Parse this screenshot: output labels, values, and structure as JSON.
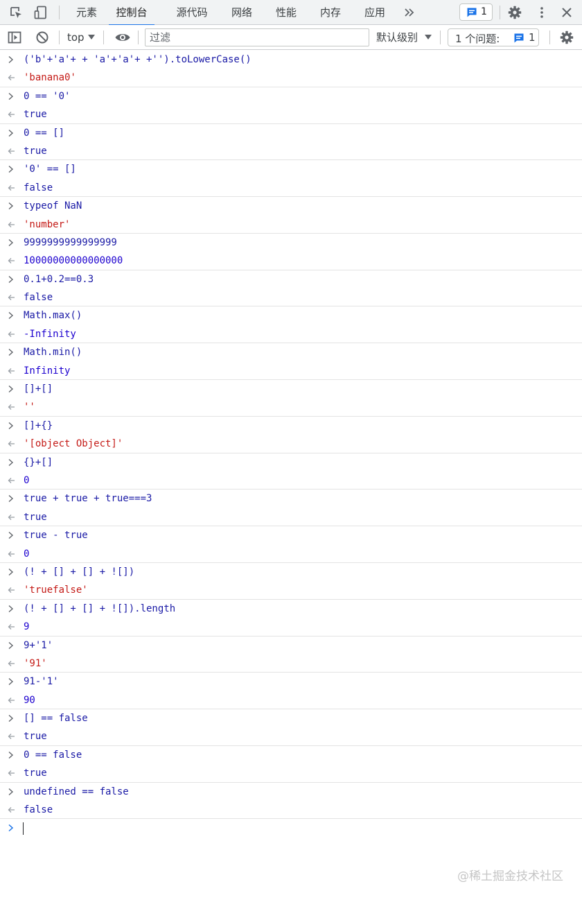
{
  "tabs": [
    {
      "label": "元素"
    },
    {
      "label": "控制台"
    },
    {
      "label": "源代码"
    },
    {
      "label": "网络"
    },
    {
      "label": "性能"
    },
    {
      "label": "内存"
    },
    {
      "label": "应用"
    }
  ],
  "active_tab": "控制台",
  "issues_badge_count": "1",
  "toolbar": {
    "context": "top",
    "filter_placeholder": "过滤",
    "level": "默认级别",
    "issues_label": "1 个问题:",
    "issues_count": "1"
  },
  "colors": {
    "accent": "#1a73e8",
    "string": "#c41a16",
    "number": "#1c00cf",
    "keyword": "#aa0d91",
    "input": "#1a1aa6"
  },
  "console": [
    {
      "input": "('b'+'a'+ + 'a'+'a'+ +'').toLowerCase()",
      "output": "'banana0'",
      "out_type": "string"
    },
    {
      "input": "0 == '0'",
      "output": "true",
      "out_type": "keyword"
    },
    {
      "input": "0 == []",
      "output": "true",
      "out_type": "keyword"
    },
    {
      "input": "'0' == []",
      "output": "false",
      "out_type": "keyword"
    },
    {
      "input": "typeof NaN",
      "output": "'number'",
      "out_type": "string"
    },
    {
      "input": "9999999999999999",
      "output": "10000000000000000",
      "out_type": "number"
    },
    {
      "input": "0.1+0.2==0.3",
      "output": "false",
      "out_type": "keyword"
    },
    {
      "input": "Math.max()",
      "output": "-Infinity",
      "out_type": "number"
    },
    {
      "input": "Math.min()",
      "output": "Infinity",
      "out_type": "number"
    },
    {
      "input": "[]+[]",
      "output": "''",
      "out_type": "string"
    },
    {
      "input": "[]+{}",
      "output": "'[object Object]'",
      "out_type": "string"
    },
    {
      "input": "{}+[]",
      "output": "0",
      "out_type": "number"
    },
    {
      "input": "true + true + true===3",
      "output": "true",
      "out_type": "keyword"
    },
    {
      "input": "true - true",
      "output": "0",
      "out_type": "number"
    },
    {
      "input": "(! + [] + [] + ![])",
      "output": "'truefalse'",
      "out_type": "string"
    },
    {
      "input": "(! + [] + [] + ![]).length",
      "output": "9",
      "out_type": "number"
    },
    {
      "input": "9+'1'",
      "output": "'91'",
      "out_type": "string"
    },
    {
      "input": "91-'1'",
      "output": "90",
      "out_type": "number"
    },
    {
      "input": "[] == false",
      "output": "true",
      "out_type": "keyword"
    },
    {
      "input": "0 == false",
      "output": "true",
      "out_type": "keyword"
    },
    {
      "input": "undefined == false",
      "output": "false",
      "out_type": "keyword"
    }
  ],
  "watermark": "@稀土掘金技术社区"
}
